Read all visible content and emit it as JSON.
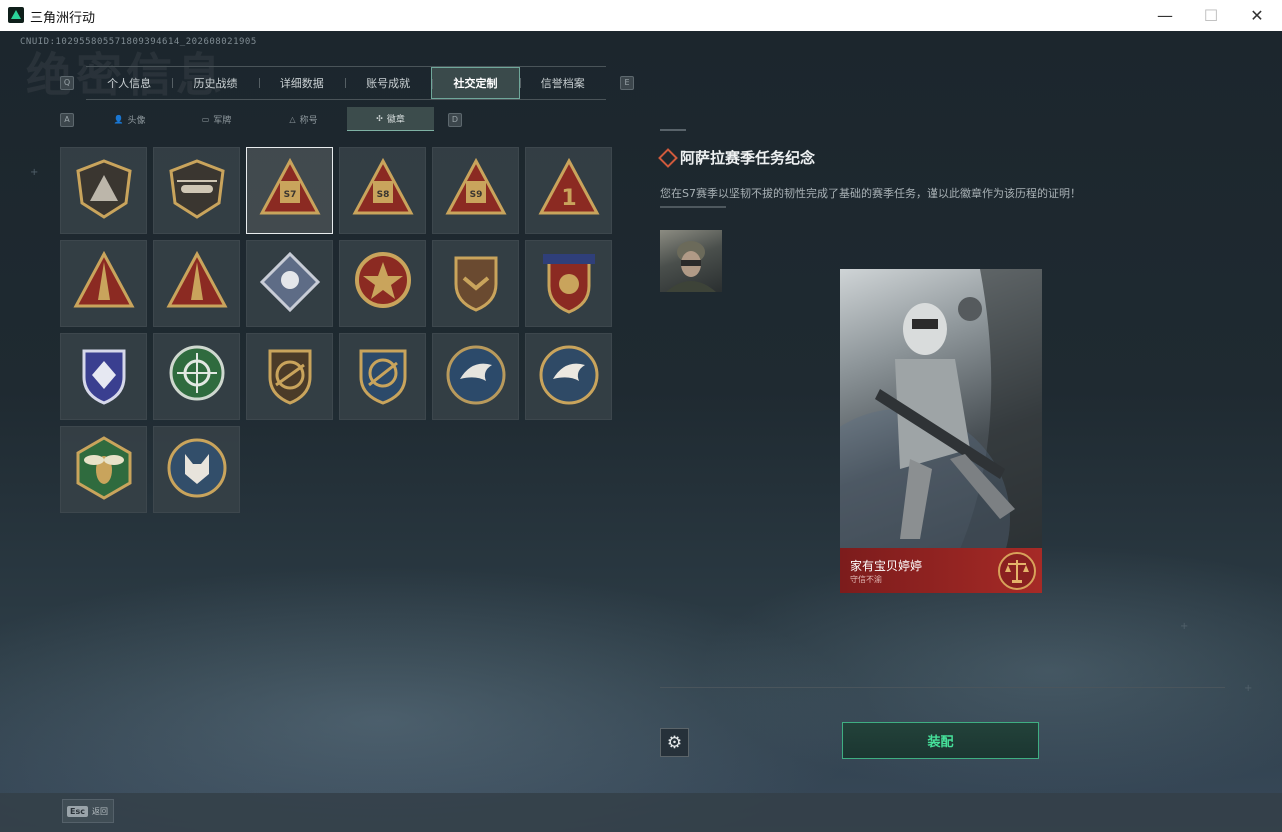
{
  "window": {
    "title": "三角洲行动",
    "minimize": "—",
    "maximize": "☐",
    "close": "✕"
  },
  "header": {
    "uid": "CNUID:102955805571809394614_202608021905",
    "bg_title": "绝密信息"
  },
  "keys": {
    "tab_prev": "Q",
    "tab_next": "E",
    "subtab_prev": "A",
    "subtab_next": "D"
  },
  "tabs": [
    {
      "label": "个人信息",
      "active": false
    },
    {
      "label": "历史战绩",
      "active": false
    },
    {
      "label": "详细数据",
      "active": false
    },
    {
      "label": "账号成就",
      "active": false
    },
    {
      "label": "社交定制",
      "active": true
    },
    {
      "label": "信誉档案",
      "active": false
    }
  ],
  "subtabs": [
    {
      "label": "头像",
      "icon": "person-icon",
      "active": false
    },
    {
      "label": "军牌",
      "icon": "dogtag-icon",
      "active": false
    },
    {
      "label": "称号",
      "icon": "triangle-icon",
      "active": false
    },
    {
      "label": "徽章",
      "icon": "emblem-icon",
      "active": true
    }
  ],
  "badges": [
    {
      "icon": "delta-shield-badge",
      "selected": false
    },
    {
      "icon": "helicopter-badge",
      "selected": false
    },
    {
      "icon": "s7-badge",
      "selected": true,
      "text": "S7"
    },
    {
      "icon": "s8-badge",
      "selected": false,
      "text": "S8"
    },
    {
      "icon": "s9-badge",
      "selected": false,
      "text": "S9"
    },
    {
      "icon": "rank-one-badge",
      "selected": false,
      "text": "1"
    },
    {
      "icon": "soldiers-badge",
      "selected": false
    },
    {
      "icon": "rocket-badge",
      "selected": false
    },
    {
      "icon": "rose-diamond-badge",
      "selected": false
    },
    {
      "icon": "star-medal-badge",
      "selected": false
    },
    {
      "icon": "chevron-shield-badge",
      "selected": false
    },
    {
      "icon": "three-star-shield-badge",
      "selected": false
    },
    {
      "icon": "crystal-shield-badge",
      "selected": false
    },
    {
      "icon": "green-crosshair-badge",
      "selected": false
    },
    {
      "icon": "rifle-shield-badge",
      "selected": false
    },
    {
      "icon": "gold-crosshair-badge",
      "selected": false
    },
    {
      "icon": "eagle-blue-badge",
      "selected": false
    },
    {
      "icon": "eagle-gold-badge",
      "selected": false
    },
    {
      "icon": "wasp-badge",
      "selected": false
    },
    {
      "icon": "wolf-badge",
      "selected": false
    }
  ],
  "detail": {
    "title": "阿萨拉赛季任务纪念",
    "description": "您在S7赛季以坚韧不拔的韧性完成了基础的赛季任务，谨以此徽章作为该历程的证明！",
    "card_name": "家有宝贝婷婷",
    "card_subtitle": "守信不渝",
    "equip_label": "装配"
  },
  "bottom": {
    "esc_key": "Esc",
    "esc_label": "返回"
  },
  "colors": {
    "accent_green": "#46e09a",
    "card_red": "#a62a26",
    "gold": "#c9a45c"
  }
}
